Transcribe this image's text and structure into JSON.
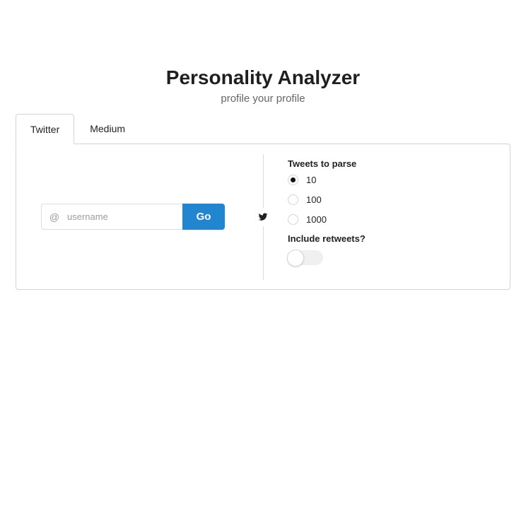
{
  "header": {
    "title": "Personality Analyzer",
    "subtitle": "profile your profile"
  },
  "tabs": [
    {
      "label": "Twitter",
      "active": true
    },
    {
      "label": "Medium",
      "active": false
    }
  ],
  "search": {
    "prefix": "@",
    "placeholder": "username",
    "value": "",
    "button_label": "Go"
  },
  "divider_icon": "twitter-icon",
  "options": {
    "tweets_label": "Tweets to parse",
    "tweet_counts": [
      {
        "label": "10",
        "checked": true
      },
      {
        "label": "100",
        "checked": false
      },
      {
        "label": "1000",
        "checked": false
      }
    ],
    "retweets_label": "Include retweets?",
    "include_retweets": false
  },
  "colors": {
    "accent": "#2185d0",
    "border": "#d4d4d5"
  }
}
